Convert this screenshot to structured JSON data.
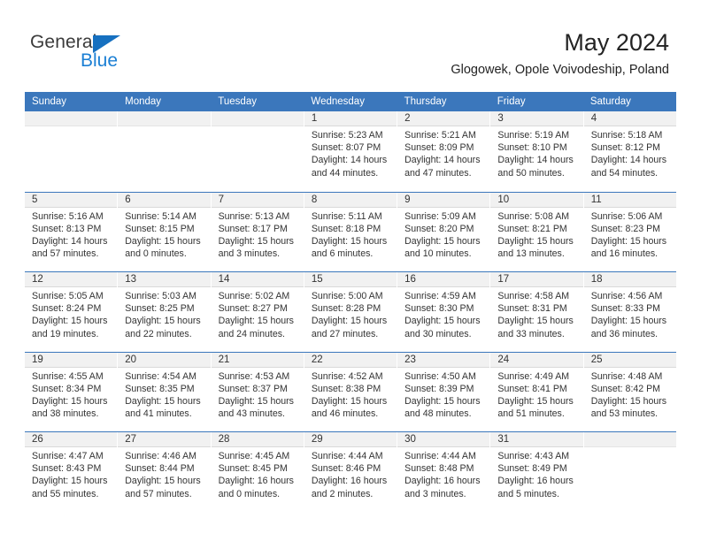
{
  "brand": {
    "name_part1": "General",
    "name_part2": "Blue",
    "triangle_color": "#1670c0",
    "blue_color": "#1b7fd4"
  },
  "header": {
    "title": "May 2024",
    "subtitle": "Glogowek, Opole Voivodeship, Poland"
  },
  "theme": {
    "header_bg": "#3b77bc",
    "header_text": "#ffffff",
    "daynum_strip_bg": "#f1f1f1",
    "grid_line": "#3b77bc",
    "body_text": "#333333"
  },
  "weekdays": [
    "Sunday",
    "Monday",
    "Tuesday",
    "Wednesday",
    "Thursday",
    "Friday",
    "Saturday"
  ],
  "weeks": [
    [
      {
        "empty": true
      },
      {
        "empty": true
      },
      {
        "empty": true
      },
      {
        "day": "1",
        "l1": "Sunrise: 5:23 AM",
        "l2": "Sunset: 8:07 PM",
        "l3": "Daylight: 14 hours",
        "l4": "and 44 minutes."
      },
      {
        "day": "2",
        "l1": "Sunrise: 5:21 AM",
        "l2": "Sunset: 8:09 PM",
        "l3": "Daylight: 14 hours",
        "l4": "and 47 minutes."
      },
      {
        "day": "3",
        "l1": "Sunrise: 5:19 AM",
        "l2": "Sunset: 8:10 PM",
        "l3": "Daylight: 14 hours",
        "l4": "and 50 minutes."
      },
      {
        "day": "4",
        "l1": "Sunrise: 5:18 AM",
        "l2": "Sunset: 8:12 PM",
        "l3": "Daylight: 14 hours",
        "l4": "and 54 minutes."
      }
    ],
    [
      {
        "day": "5",
        "l1": "Sunrise: 5:16 AM",
        "l2": "Sunset: 8:13 PM",
        "l3": "Daylight: 14 hours",
        "l4": "and 57 minutes."
      },
      {
        "day": "6",
        "l1": "Sunrise: 5:14 AM",
        "l2": "Sunset: 8:15 PM",
        "l3": "Daylight: 15 hours",
        "l4": "and 0 minutes."
      },
      {
        "day": "7",
        "l1": "Sunrise: 5:13 AM",
        "l2": "Sunset: 8:17 PM",
        "l3": "Daylight: 15 hours",
        "l4": "and 3 minutes."
      },
      {
        "day": "8",
        "l1": "Sunrise: 5:11 AM",
        "l2": "Sunset: 8:18 PM",
        "l3": "Daylight: 15 hours",
        "l4": "and 6 minutes."
      },
      {
        "day": "9",
        "l1": "Sunrise: 5:09 AM",
        "l2": "Sunset: 8:20 PM",
        "l3": "Daylight: 15 hours",
        "l4": "and 10 minutes."
      },
      {
        "day": "10",
        "l1": "Sunrise: 5:08 AM",
        "l2": "Sunset: 8:21 PM",
        "l3": "Daylight: 15 hours",
        "l4": "and 13 minutes."
      },
      {
        "day": "11",
        "l1": "Sunrise: 5:06 AM",
        "l2": "Sunset: 8:23 PM",
        "l3": "Daylight: 15 hours",
        "l4": "and 16 minutes."
      }
    ],
    [
      {
        "day": "12",
        "l1": "Sunrise: 5:05 AM",
        "l2": "Sunset: 8:24 PM",
        "l3": "Daylight: 15 hours",
        "l4": "and 19 minutes."
      },
      {
        "day": "13",
        "l1": "Sunrise: 5:03 AM",
        "l2": "Sunset: 8:25 PM",
        "l3": "Daylight: 15 hours",
        "l4": "and 22 minutes."
      },
      {
        "day": "14",
        "l1": "Sunrise: 5:02 AM",
        "l2": "Sunset: 8:27 PM",
        "l3": "Daylight: 15 hours",
        "l4": "and 24 minutes."
      },
      {
        "day": "15",
        "l1": "Sunrise: 5:00 AM",
        "l2": "Sunset: 8:28 PM",
        "l3": "Daylight: 15 hours",
        "l4": "and 27 minutes."
      },
      {
        "day": "16",
        "l1": "Sunrise: 4:59 AM",
        "l2": "Sunset: 8:30 PM",
        "l3": "Daylight: 15 hours",
        "l4": "and 30 minutes."
      },
      {
        "day": "17",
        "l1": "Sunrise: 4:58 AM",
        "l2": "Sunset: 8:31 PM",
        "l3": "Daylight: 15 hours",
        "l4": "and 33 minutes."
      },
      {
        "day": "18",
        "l1": "Sunrise: 4:56 AM",
        "l2": "Sunset: 8:33 PM",
        "l3": "Daylight: 15 hours",
        "l4": "and 36 minutes."
      }
    ],
    [
      {
        "day": "19",
        "l1": "Sunrise: 4:55 AM",
        "l2": "Sunset: 8:34 PM",
        "l3": "Daylight: 15 hours",
        "l4": "and 38 minutes."
      },
      {
        "day": "20",
        "l1": "Sunrise: 4:54 AM",
        "l2": "Sunset: 8:35 PM",
        "l3": "Daylight: 15 hours",
        "l4": "and 41 minutes."
      },
      {
        "day": "21",
        "l1": "Sunrise: 4:53 AM",
        "l2": "Sunset: 8:37 PM",
        "l3": "Daylight: 15 hours",
        "l4": "and 43 minutes."
      },
      {
        "day": "22",
        "l1": "Sunrise: 4:52 AM",
        "l2": "Sunset: 8:38 PM",
        "l3": "Daylight: 15 hours",
        "l4": "and 46 minutes."
      },
      {
        "day": "23",
        "l1": "Sunrise: 4:50 AM",
        "l2": "Sunset: 8:39 PM",
        "l3": "Daylight: 15 hours",
        "l4": "and 48 minutes."
      },
      {
        "day": "24",
        "l1": "Sunrise: 4:49 AM",
        "l2": "Sunset: 8:41 PM",
        "l3": "Daylight: 15 hours",
        "l4": "and 51 minutes."
      },
      {
        "day": "25",
        "l1": "Sunrise: 4:48 AM",
        "l2": "Sunset: 8:42 PM",
        "l3": "Daylight: 15 hours",
        "l4": "and 53 minutes."
      }
    ],
    [
      {
        "day": "26",
        "l1": "Sunrise: 4:47 AM",
        "l2": "Sunset: 8:43 PM",
        "l3": "Daylight: 15 hours",
        "l4": "and 55 minutes."
      },
      {
        "day": "27",
        "l1": "Sunrise: 4:46 AM",
        "l2": "Sunset: 8:44 PM",
        "l3": "Daylight: 15 hours",
        "l4": "and 57 minutes."
      },
      {
        "day": "28",
        "l1": "Sunrise: 4:45 AM",
        "l2": "Sunset: 8:45 PM",
        "l3": "Daylight: 16 hours",
        "l4": "and 0 minutes."
      },
      {
        "day": "29",
        "l1": "Sunrise: 4:44 AM",
        "l2": "Sunset: 8:46 PM",
        "l3": "Daylight: 16 hours",
        "l4": "and 2 minutes."
      },
      {
        "day": "30",
        "l1": "Sunrise: 4:44 AM",
        "l2": "Sunset: 8:48 PM",
        "l3": "Daylight: 16 hours",
        "l4": "and 3 minutes."
      },
      {
        "day": "31",
        "l1": "Sunrise: 4:43 AM",
        "l2": "Sunset: 8:49 PM",
        "l3": "Daylight: 16 hours",
        "l4": "and 5 minutes."
      },
      {
        "empty": true
      }
    ]
  ]
}
